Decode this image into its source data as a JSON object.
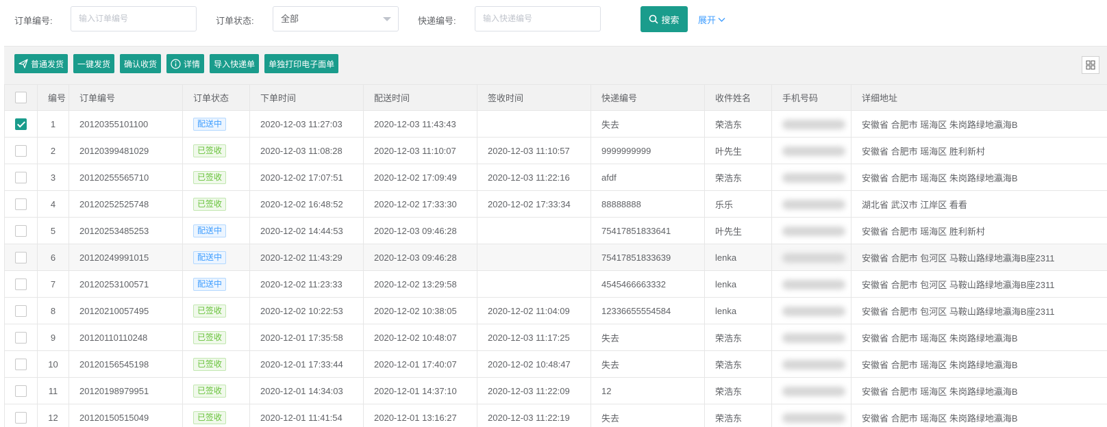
{
  "search": {
    "order_no_label": "订单编号:",
    "order_no_placeholder": "输入订单编号",
    "status_label": "订单状态:",
    "status_value": "全部",
    "express_label": "快递编号:",
    "express_placeholder": "输入快递编号",
    "search_button": "搜索",
    "expand_link": "展开"
  },
  "toolbar": {
    "buttons": [
      "普通发货",
      "一键发货",
      "确认收货",
      "详情",
      "导入快递单",
      "单独打印电子面单"
    ]
  },
  "table": {
    "headers": [
      "编号",
      "订单编号",
      "订单状态",
      "下单时间",
      "配送时间",
      "签收时间",
      "快递编号",
      "收件姓名",
      "手机号码",
      "详细地址"
    ],
    "rows": [
      {
        "checked": true,
        "no": "1",
        "order": "20120355101100",
        "status": "配送中",
        "status_color": "blue",
        "ordered": "2020-12-03 11:27:03",
        "shipped": "2020-12-03 11:43:43",
        "signed": "",
        "express": "失去",
        "name": "荣浩东",
        "address": "安徽省 合肥市 瑶海区 朱岗路绿地瀛海B"
      },
      {
        "checked": false,
        "no": "2",
        "order": "20120399481029",
        "status": "已签收",
        "status_color": "green",
        "ordered": "2020-12-03 11:08:28",
        "shipped": "2020-12-03 11:10:07",
        "signed": "2020-12-03 11:10:57",
        "express": "9999999999",
        "name": "叶先生",
        "address": "安徽省 合肥市 瑶海区 胜利新村"
      },
      {
        "checked": false,
        "no": "3",
        "order": "20120255565710",
        "status": "已签收",
        "status_color": "green",
        "ordered": "2020-12-02 17:07:51",
        "shipped": "2020-12-02 17:09:49",
        "signed": "2020-12-03 11:22:16",
        "express": "afdf",
        "name": "荣浩东",
        "address": "安徽省 合肥市 瑶海区 朱岗路绿地瀛海B"
      },
      {
        "checked": false,
        "no": "4",
        "order": "20120252525748",
        "status": "已签收",
        "status_color": "green",
        "ordered": "2020-12-02 16:48:52",
        "shipped": "2020-12-02 17:33:30",
        "signed": "2020-12-02 17:33:34",
        "express": "88888888",
        "name": "乐乐",
        "address": "湖北省 武汉市 江岸区 看看"
      },
      {
        "checked": false,
        "no": "5",
        "order": "20120253485253",
        "status": "配送中",
        "status_color": "blue",
        "ordered": "2020-12-02 14:44:53",
        "shipped": "2020-12-03 09:46:28",
        "signed": "",
        "express": "75417851833641",
        "name": "叶先生",
        "address": "安徽省 合肥市 瑶海区 胜利新村"
      },
      {
        "checked": false,
        "no": "6",
        "order": "20120249991015",
        "status": "配送中",
        "status_color": "blue",
        "ordered": "2020-12-02 11:43:29",
        "shipped": "2020-12-03 09:46:28",
        "signed": "",
        "express": "75417851833639",
        "name": "lenka",
        "address": "安徽省 合肥市 包河区 马鞍山路绿地瀛海B座2311"
      },
      {
        "checked": false,
        "no": "7",
        "order": "20120253100571",
        "status": "配送中",
        "status_color": "blue",
        "ordered": "2020-12-02 11:23:33",
        "shipped": "2020-12-02 13:29:58",
        "signed": "",
        "express": "4545466663332",
        "name": "lenka",
        "address": "安徽省 合肥市 包河区 马鞍山路绿地瀛海B座2311"
      },
      {
        "checked": false,
        "no": "8",
        "order": "20120210057495",
        "status": "已签收",
        "status_color": "green",
        "ordered": "2020-12-02 10:22:53",
        "shipped": "2020-12-02 10:38:05",
        "signed": "2020-12-02 11:04:09",
        "express": "12336655554584",
        "name": "lenka",
        "address": "安徽省 合肥市 包河区 马鞍山路绿地瀛海B座2311"
      },
      {
        "checked": false,
        "no": "9",
        "order": "20120110110248",
        "status": "已签收",
        "status_color": "green",
        "ordered": "2020-12-01 17:35:58",
        "shipped": "2020-12-02 10:48:07",
        "signed": "2020-12-03 11:17:25",
        "express": "失去",
        "name": "荣浩东",
        "address": "安徽省 合肥市 瑶海区 朱岗路绿地瀛海B"
      },
      {
        "checked": false,
        "no": "10",
        "order": "20120156545198",
        "status": "已签收",
        "status_color": "green",
        "ordered": "2020-12-01 17:33:44",
        "shipped": "2020-12-01 17:40:07",
        "signed": "2020-12-02 10:48:47",
        "express": "失去",
        "name": "荣浩东",
        "address": "安徽省 合肥市 瑶海区 朱岗路绿地瀛海B"
      },
      {
        "checked": false,
        "no": "11",
        "order": "20120198979951",
        "status": "已签收",
        "status_color": "green",
        "ordered": "2020-12-01 14:34:03",
        "shipped": "2020-12-01 14:37:10",
        "signed": "2020-12-03 11:22:09",
        "express": "12",
        "name": "荣浩东",
        "address": "安徽省 合肥市 瑶海区 朱岗路绿地瀛海B"
      },
      {
        "checked": false,
        "no": "12",
        "order": "20120150515049",
        "status": "已签收",
        "status_color": "green",
        "ordered": "2020-12-01 11:41:54",
        "shipped": "2020-12-01 13:16:27",
        "signed": "2020-12-03 11:22:19",
        "express": "失去",
        "name": "荣浩东",
        "address": "安徽省 合肥市 瑶海区 朱岗路绿地瀛海B"
      }
    ]
  },
  "colors": {
    "primary": "#1a9c8c",
    "link": "#409eff",
    "tag_blue": "#409eff",
    "tag_green": "#67c23a"
  }
}
